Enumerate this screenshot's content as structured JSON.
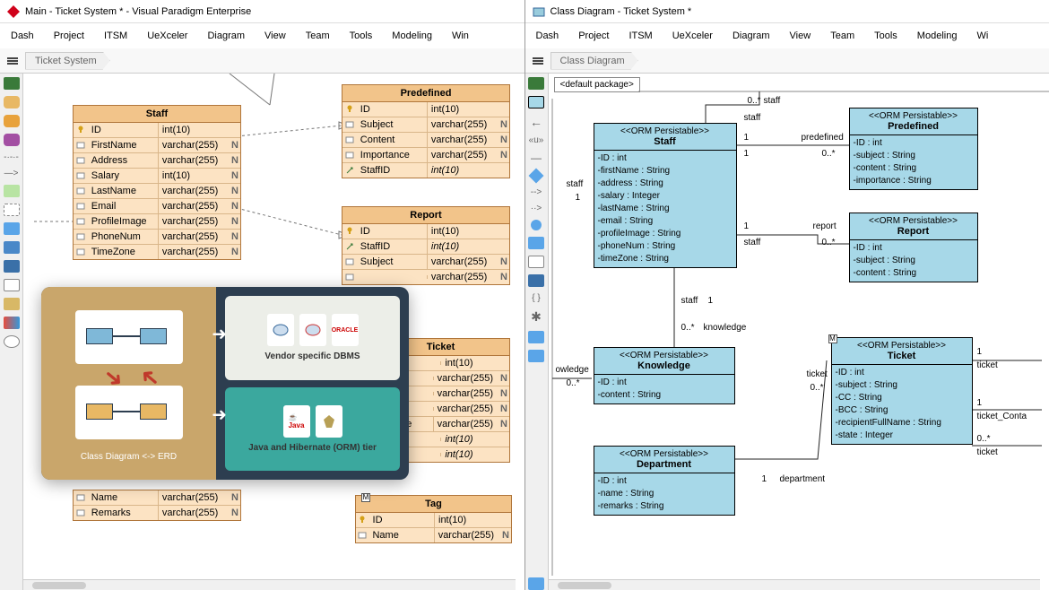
{
  "left": {
    "title": "Main - Ticket System * - Visual Paradigm Enterprise",
    "menu": [
      "Dash",
      "Project",
      "ITSM",
      "UeXceler",
      "Diagram",
      "View",
      "Team",
      "Tools",
      "Modeling",
      "Win"
    ],
    "breadcrumb": "Ticket System",
    "entities": {
      "staff": {
        "name": "Staff",
        "cols": [
          {
            "key": true,
            "name": "ID",
            "type": "int(10)",
            "null": ""
          },
          {
            "key": false,
            "name": "FirstName",
            "type": "varchar(255)",
            "null": "N"
          },
          {
            "key": false,
            "name": "Address",
            "type": "varchar(255)",
            "null": "N"
          },
          {
            "key": false,
            "name": "Salary",
            "type": "int(10)",
            "null": "N"
          },
          {
            "key": false,
            "name": "LastName",
            "type": "varchar(255)",
            "null": "N"
          },
          {
            "key": false,
            "name": "Email",
            "type": "varchar(255)",
            "null": "N"
          },
          {
            "key": false,
            "name": "ProfileImage",
            "type": "varchar(255)",
            "null": "N"
          },
          {
            "key": false,
            "name": "PhoneNum",
            "type": "varchar(255)",
            "null": "N"
          },
          {
            "key": false,
            "name": "TimeZone",
            "type": "varchar(255)",
            "null": "N"
          }
        ]
      },
      "predefined": {
        "name": "Predefined",
        "cols": [
          {
            "key": true,
            "name": "ID",
            "type": "int(10)",
            "null": ""
          },
          {
            "key": false,
            "name": "Subject",
            "type": "varchar(255)",
            "null": "N"
          },
          {
            "key": false,
            "name": "Content",
            "type": "varchar(255)",
            "null": "N"
          },
          {
            "key": false,
            "name": "Importance",
            "type": "varchar(255)",
            "null": "N"
          },
          {
            "key": false,
            "fk": true,
            "name": "StaffID",
            "type": "int(10)",
            "null": "",
            "italic": true
          }
        ]
      },
      "report": {
        "name": "Report",
        "cols": [
          {
            "key": true,
            "name": "ID",
            "type": "int(10)",
            "null": ""
          },
          {
            "key": false,
            "fk": true,
            "name": "StaffID",
            "type": "int(10)",
            "null": "",
            "italic": true
          },
          {
            "key": false,
            "name": "Subject",
            "type": "varchar(255)",
            "null": "N"
          },
          {
            "key": false,
            "name": "",
            "type": "varchar(255)",
            "null": "N"
          }
        ]
      },
      "ticket": {
        "name": "Ticket",
        "cols": [
          {
            "key": true,
            "name": "",
            "type": "int(10)",
            "null": ""
          },
          {
            "key": false,
            "name": "",
            "type": "varchar(255)",
            "null": "N"
          },
          {
            "key": false,
            "name": "",
            "type": "varchar(255)",
            "null": "N"
          },
          {
            "key": false,
            "name": "",
            "type": "varchar(255)",
            "null": "N"
          },
          {
            "key": false,
            "name": "Name",
            "type": "varchar(255)",
            "null": "N"
          },
          {
            "key": false,
            "name": "",
            "type": "int(10)",
            "null": "",
            "italic": true
          },
          {
            "key": false,
            "name": "",
            "type": "int(10)",
            "null": "",
            "italic": true
          }
        ]
      },
      "dept": {
        "name": "",
        "cols": [
          {
            "key": false,
            "name": "Name",
            "type": "varchar(255)",
            "null": "N"
          },
          {
            "key": false,
            "name": "Remarks",
            "type": "varchar(255)",
            "null": "N"
          }
        ]
      },
      "tag": {
        "name": "Tag",
        "cols": [
          {
            "key": true,
            "name": "ID",
            "type": "int(10)",
            "null": ""
          },
          {
            "key": false,
            "name": "Name",
            "type": "varchar(255)",
            "null": "N"
          }
        ]
      }
    },
    "promo": {
      "caption": "Class Diagram <-> ERD",
      "top": "Vendor specific DBMS",
      "bot": "Java and Hibernate (ORM) tier"
    }
  },
  "right": {
    "title": "Class Diagram - Ticket System *",
    "menu": [
      "Dash",
      "Project",
      "ITSM",
      "UeXceler",
      "Diagram",
      "View",
      "Team",
      "Tools",
      "Modeling",
      "Wi"
    ],
    "breadcrumb": "Class Diagram",
    "package": "<default package>",
    "classes": {
      "staff": {
        "stereo": "<<ORM Persistable>>",
        "name": "Staff",
        "attrs": [
          "-ID : int",
          "-firstName : String",
          "-address : String",
          "-salary : Integer",
          "-lastName : String",
          "-email : String",
          "-profileImage : String",
          "-phoneNum : String",
          "-timeZone : String"
        ]
      },
      "predefined": {
        "stereo": "<<ORM Persistable>>",
        "name": "Predefined",
        "attrs": [
          "-ID : int",
          "-subject : String",
          "-content : String",
          "-importance : String"
        ]
      },
      "report": {
        "stereo": "<<ORM Persistable>>",
        "name": "Report",
        "attrs": [
          "-ID : int",
          "-subject : String",
          "-content : String"
        ]
      },
      "knowledge": {
        "stereo": "<<ORM Persistable>>",
        "name": "Knowledge",
        "attrs": [
          "-ID : int",
          "-content : String"
        ]
      },
      "ticket": {
        "stereo": "<<ORM Persistable>>",
        "name": "Ticket",
        "attrs": [
          "-ID : int",
          "-subject : String",
          "-CC : String",
          "-BCC : String",
          "-recipientFullName : String",
          "-state : Integer"
        ]
      },
      "department": {
        "stereo": "<<ORM Persistable>>",
        "name": "Department",
        "attrs": [
          "-ID : int",
          "-name : String",
          "-remarks : String"
        ]
      }
    },
    "labels": {
      "staff_self_m": "0..*",
      "staff_self_r": "staff",
      "staff_self_1": "1",
      "staff_self_r2": "staff",
      "pred_1": "1",
      "pred_r": "predefined",
      "pred_m": "0..*",
      "rep_1": "1",
      "rep_r": "report",
      "rep_s": "staff",
      "rep_m": "0..*",
      "know_staff": "staff",
      "know_1": "1",
      "know_r": "knowledge",
      "know_m1": "0..*",
      "know_m2": "0..*",
      "know_role": "owledge",
      "tic_r": "ticket",
      "tic_m": "0..*",
      "tic_1a": "1",
      "tic_ra": "ticket",
      "tic_1b": "1",
      "tic_rb": "ticket_Conta",
      "tic_mc": "0..*",
      "tic_rc": "ticket",
      "dep_1": "1",
      "dep_r": "department"
    }
  }
}
